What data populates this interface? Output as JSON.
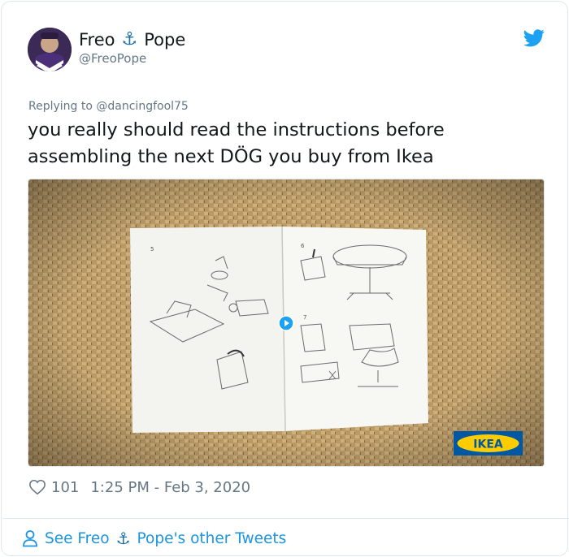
{
  "author": {
    "name_first": "Freo",
    "name_last": "Pope",
    "handle": "@FreoPope"
  },
  "reply": {
    "prefix": "Replying to",
    "to_handle": "@dancingfool75"
  },
  "tweet": {
    "text": "you really should read the instructions before assembling the next DÖG you buy from Ikea"
  },
  "media": {
    "logo_text": "IKEA",
    "page_numbers": [
      "5",
      "6",
      "7"
    ]
  },
  "meta": {
    "likes": "101",
    "timestamp": "1:25 PM - Feb 3, 2020"
  },
  "footer": {
    "prefix": "See Freo",
    "suffix": "Pope's other Tweets"
  },
  "icons": {
    "brand": "twitter-bird-icon",
    "anchor": "anchor-icon",
    "like": "heart-icon",
    "profile": "person-icon"
  },
  "colors": {
    "twitter_blue": "#1da1f2",
    "link_blue": "#1b95e0",
    "muted_text": "#657786",
    "anchor_blue": "#1b6fa8",
    "ikea_blue": "#0058a3",
    "ikea_yellow": "#ffcc00"
  }
}
